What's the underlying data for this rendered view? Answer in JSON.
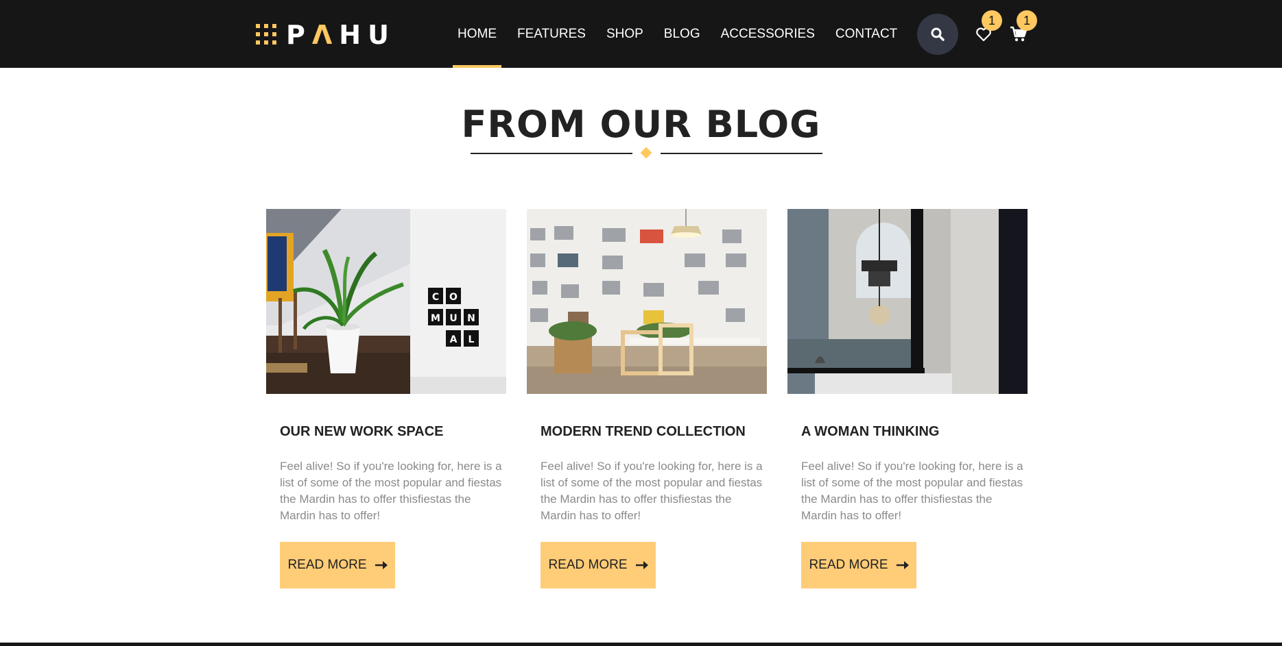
{
  "brand": {
    "logo_prefix": "P",
    "logo_accent": "Λ",
    "logo_suffix": "HU"
  },
  "nav": {
    "items": [
      {
        "label": "HOME",
        "active": true
      },
      {
        "label": "FEATURES"
      },
      {
        "label": "SHOP"
      },
      {
        "label": "BLOG"
      },
      {
        "label": "ACCESSORIES"
      },
      {
        "label": "CONTACT"
      }
    ]
  },
  "header_icons": {
    "search": "search-icon",
    "wishlist": "heart-icon",
    "cart": "cart-icon",
    "wishlist_count": "1",
    "cart_count": "1"
  },
  "section": {
    "title": "FROM OUR BLOG"
  },
  "posts": [
    {
      "title": "OUR NEW WORK SPACE",
      "excerpt": "Feel alive! So if you're looking for, here is a list of some of the most popular and fiestas the Mardin has to offer thisfiestas the Mardin has to offer!",
      "button": "READ MORE",
      "sign_text": [
        "CO",
        "MUN",
        "AL"
      ]
    },
    {
      "title": "MODERN TREND COLLECTION",
      "excerpt": "Feel alive! So if you're looking for, here is a list of some of the most popular and fiestas the Mardin has to offer thisfiestas the Mardin has to offer!",
      "button": "READ MORE"
    },
    {
      "title": "A WOMAN THINKING",
      "excerpt": "Feel alive! So if you're looking for, here is a list of some of the most popular and fiestas the Mardin has to offer thisfiestas the Mardin has to offer!",
      "button": "READ MORE"
    }
  ],
  "colors": {
    "accent": "#ffc860",
    "button": "#ffcc77",
    "header_bg": "#161616"
  }
}
